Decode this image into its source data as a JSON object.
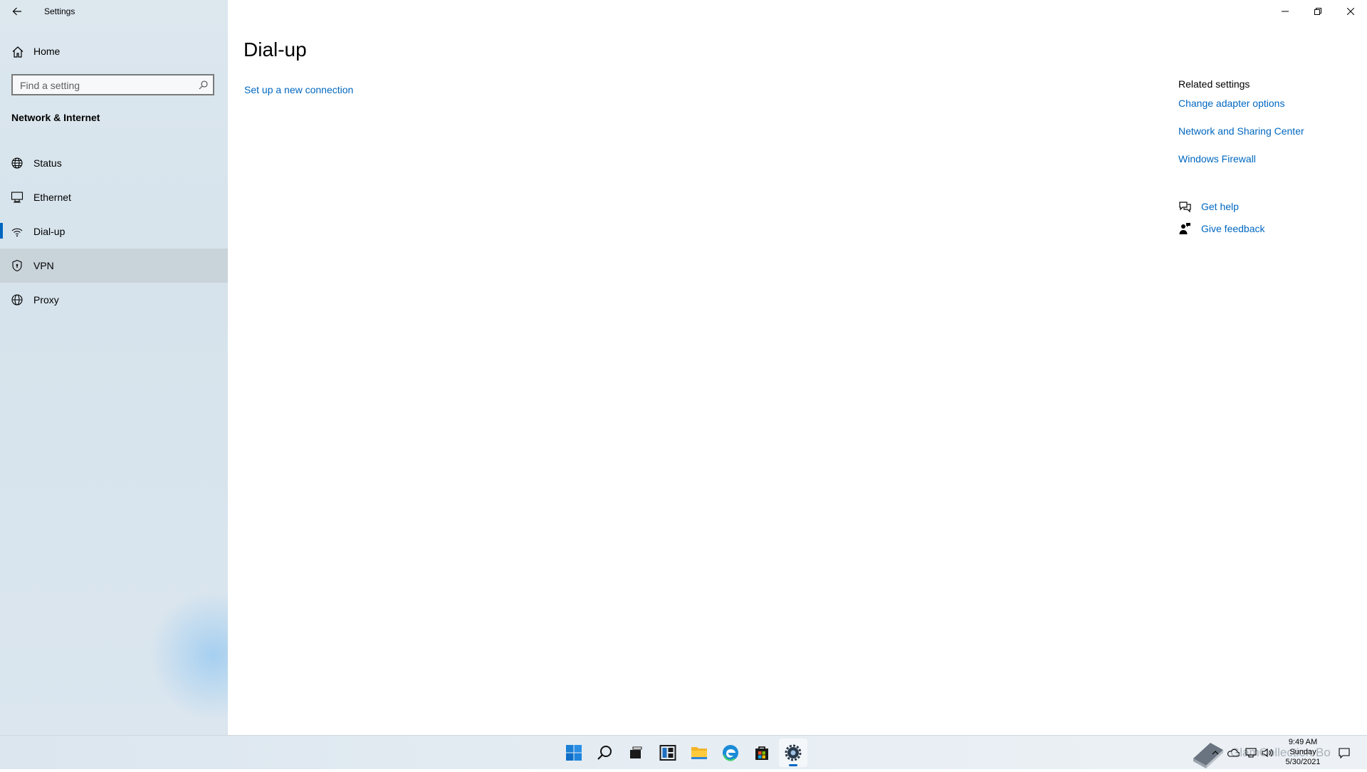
{
  "window": {
    "app_title": "Settings",
    "controls": {
      "minimize": "minimize-icon",
      "restore": "restore-icon",
      "close": "close-icon"
    }
  },
  "sidebar": {
    "home_label": "Home",
    "search_placeholder": "Find a setting",
    "section_title": "Network & Internet",
    "items": [
      {
        "label": "Status",
        "icon": "globe-status-icon"
      },
      {
        "label": "Ethernet",
        "icon": "ethernet-icon"
      },
      {
        "label": "Dial-up",
        "icon": "dialup-icon",
        "selected": true
      },
      {
        "label": "VPN",
        "icon": "vpn-shield-icon",
        "hovered": true
      },
      {
        "label": "Proxy",
        "icon": "globe-icon"
      }
    ]
  },
  "main": {
    "title": "Dial-up",
    "setup_link": "Set up a new connection",
    "related": {
      "title": "Related settings",
      "links": [
        "Change adapter options",
        "Network and Sharing Center",
        "Windows Firewall"
      ]
    },
    "help": {
      "get_help": "Get help",
      "give_feedback": "Give feedback"
    }
  },
  "taskbar": {
    "apps": [
      "start-icon",
      "search-icon",
      "task-view-icon",
      "widgets-icon",
      "file-explorer-icon",
      "edge-icon",
      "store-icon",
      "settings-icon"
    ],
    "active_app": "settings-icon",
    "clock": {
      "time": "9:49 AM",
      "day": "Sunday",
      "date": "5/30/2021"
    },
    "watermark_text": "GlamCollection Bo"
  },
  "colors": {
    "accent": "#0067c0",
    "sidebar_bg": "#d9e5ee",
    "hover": "#c9d3da"
  }
}
